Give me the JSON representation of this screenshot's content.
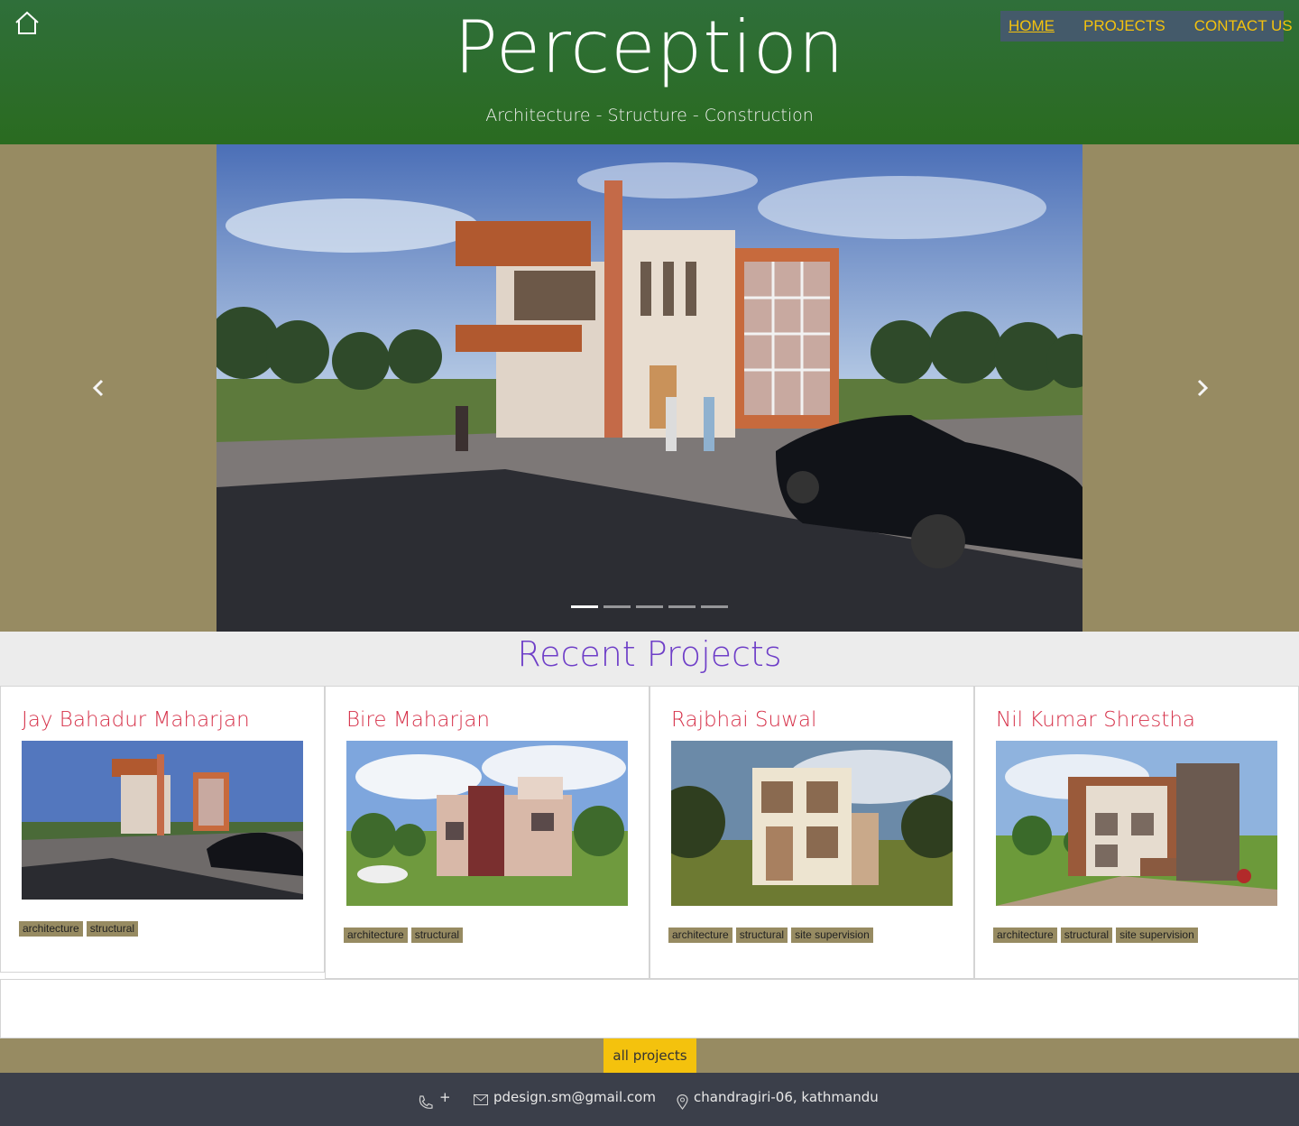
{
  "header": {
    "brand": "Perception",
    "tagline": "Architecture - Structure - Construction",
    "home_icon": "home-icon",
    "nav": [
      {
        "label": "HOME",
        "active": true
      },
      {
        "label": "PROJECTS",
        "active": false
      },
      {
        "label": "CONTACT US",
        "active": false
      }
    ]
  },
  "carousel": {
    "slide_count": 5,
    "active_index": 0,
    "prev_icon": "chevron-left-icon",
    "next_icon": "chevron-right-icon"
  },
  "recent": {
    "title": "Recent Projects",
    "projects": [
      {
        "name": "Jay Bahadur Maharjan",
        "tags": [
          "architecture",
          "structural"
        ]
      },
      {
        "name": "Bire Maharjan",
        "tags": [
          "architecture",
          "structural"
        ]
      },
      {
        "name": "Rajbhai Suwal",
        "tags": [
          "architecture",
          "structural",
          "site supervision"
        ]
      },
      {
        "name": "Nil Kumar Shrestha",
        "tags": [
          "architecture",
          "structural",
          "site supervision"
        ]
      }
    ],
    "all_projects_label": "all projects"
  },
  "footer": {
    "phone": "+",
    "email": "pdesign.sm@gmail.com",
    "address": "chandragiri-06, kathmandu"
  },
  "colors": {
    "header_green": "#2a6b20",
    "nav_bg": "#445a6a",
    "nav_text": "#f4c20d",
    "olive": "#978b62",
    "project_title": "#d6324a",
    "recent_title": "#6f3fc8",
    "footer_bg": "#3b3f4a",
    "button_yellow": "#f4c20d"
  }
}
